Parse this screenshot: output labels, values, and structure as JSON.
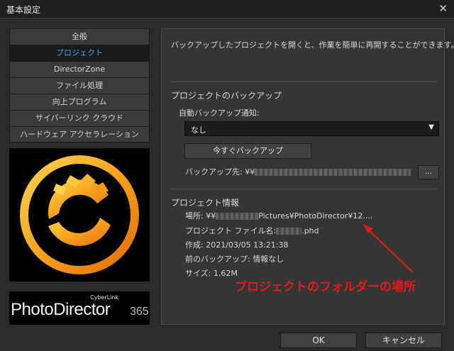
{
  "window": {
    "title": "基本設定",
    "close_glyph": "✕"
  },
  "sidebar": {
    "items": [
      {
        "label": "全般",
        "active": false
      },
      {
        "label": "プロジェクト",
        "active": true
      },
      {
        "label": "DirectorZone",
        "active": false
      },
      {
        "label": "ファイル処理",
        "active": false
      },
      {
        "label": "向上プログラム",
        "active": false
      },
      {
        "label": "サイバーリンク クラウド",
        "active": false
      },
      {
        "label": "ハードウェア アクセラレーション",
        "active": false
      }
    ]
  },
  "brand": {
    "company": "CyberLink",
    "product": "PhotoDirector",
    "version": "365",
    "accent_color": "#f5a623"
  },
  "panel": {
    "description": "バックアップしたプロジェクトを開くと、作業を簡単に再開することができます。",
    "backup_section_title": "プロジェクトのバックアップ",
    "auto_backup_label": "自動バックアップ通知:",
    "auto_backup_value": "なし",
    "backup_now_button": "今すぐバックアップ",
    "backup_dest_label": "バックアップ先: ¥¥",
    "browse_button": "...",
    "info_section_title": "プロジェクト情報",
    "location_label": "場所: ¥¥",
    "location_value": "Pictures¥PhotoDirector¥12....",
    "filename_label": "プロジェクト ファイル名:",
    "filename_ext": ".phd",
    "created": "作成: 2021/03/05 13:21:38",
    "last_backup": "前のバックアップ: 情報なし",
    "size": "サイズ: 1.62M"
  },
  "footer": {
    "ok_label": "OK",
    "cancel_label": "キャンセル"
  },
  "annotation": {
    "text": "プロジェクトのフォルダーの場所",
    "color": "#e31b1b"
  }
}
